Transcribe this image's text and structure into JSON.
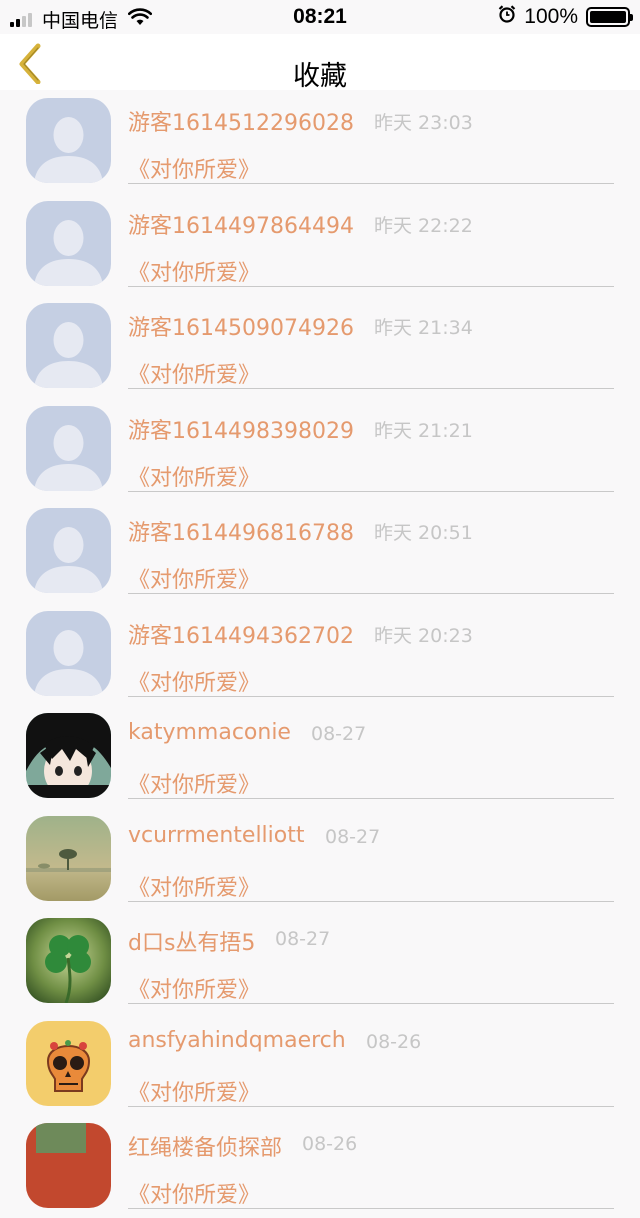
{
  "status_bar": {
    "carrier": "中国电信",
    "time": "08:21",
    "battery": "100%",
    "battery_level": 1.0
  },
  "nav": {
    "title": "收藏",
    "back_icon": "chevron-left-icon"
  },
  "colors": {
    "accent": "#e59a6e",
    "muted": "#c6c6c6",
    "back": "#d6b23a"
  },
  "items": [
    {
      "name": "游客1614512296028",
      "time": "昨天 23:03",
      "work": "《对你所爱》",
      "avatar": "default"
    },
    {
      "name": "游客1614497864494",
      "time": "昨天 22:22",
      "work": "《对你所爱》",
      "avatar": "default"
    },
    {
      "name": "游客1614509074926",
      "time": "昨天 21:34",
      "work": "《对你所爱》",
      "avatar": "default"
    },
    {
      "name": "游客1614498398029",
      "time": "昨天 21:21",
      "work": "《对你所爱》",
      "avatar": "default"
    },
    {
      "name": "游客1614496816788",
      "time": "昨天 20:51",
      "work": "《对你所爱》",
      "avatar": "default"
    },
    {
      "name": "游客1614494362702",
      "time": "昨天 20:23",
      "work": "《对你所爱》",
      "avatar": "default"
    },
    {
      "name": "katymmaconie",
      "time": "08-27",
      "work": "《对你所爱》",
      "avatar": "anime"
    },
    {
      "name": "vcurrmentelliott",
      "time": "08-27",
      "work": "《对你所爱》",
      "avatar": "landscape"
    },
    {
      "name": "d口s丛有捂5",
      "time": "08-27",
      "work": "《对你所爱》",
      "avatar": "clover"
    },
    {
      "name": "ansfyahindqmaerch",
      "time": "08-26",
      "work": "《对你所爱》",
      "avatar": "skull"
    },
    {
      "name": "红绳楼备侦探部",
      "time": "08-26",
      "work": "《对你所爱》",
      "avatar": "red"
    }
  ]
}
